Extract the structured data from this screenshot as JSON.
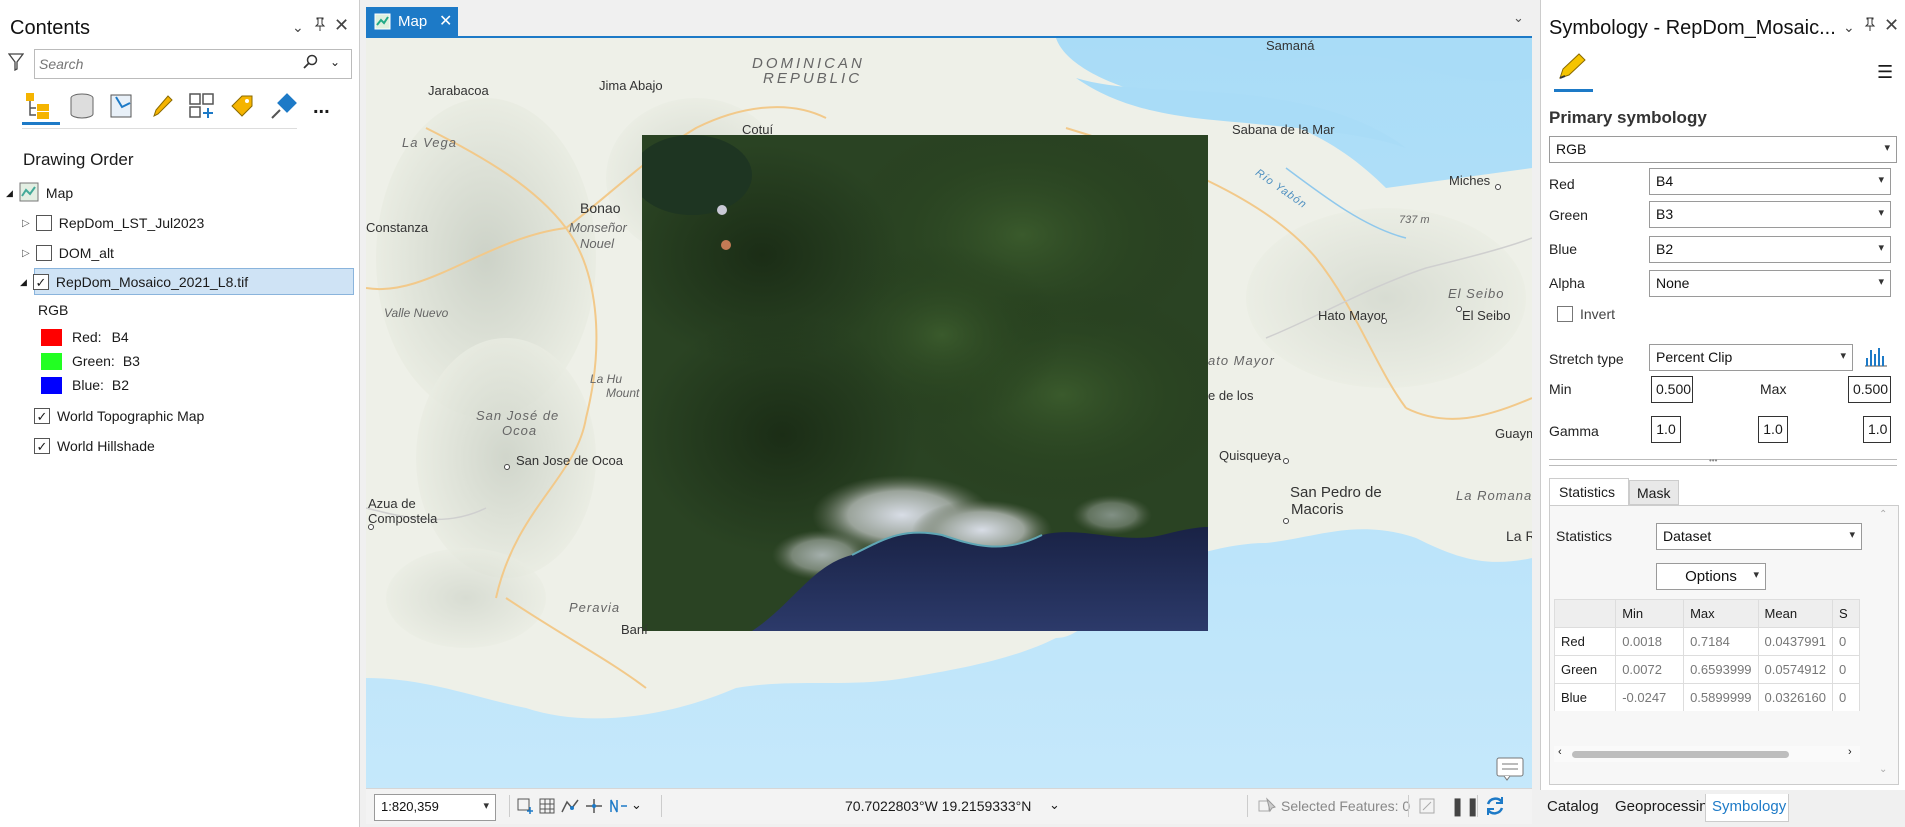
{
  "contents": {
    "title": "Contents",
    "search_placeholder": "Search",
    "drawing_order": "Drawing Order",
    "map_label": "Map",
    "layers": [
      {
        "name": "RepDom_LST_Jul2023",
        "checked": false
      },
      {
        "name": "DOM_alt",
        "checked": false
      },
      {
        "name": "RepDom_Mosaico_2021_L8.tif",
        "checked": true
      }
    ],
    "rgb_label": "RGB",
    "bands": [
      {
        "label": "Red:",
        "value": "B4",
        "color": "#ff0000"
      },
      {
        "label": "Green:",
        "value": "B3",
        "color": "#22ff22"
      },
      {
        "label": "Blue:",
        "value": "B2",
        "color": "#0000ff"
      }
    ],
    "basemaps": [
      "World Topographic Map",
      "World Hillshade"
    ],
    "more": "..."
  },
  "map": {
    "tab_label": "Map",
    "scale": "1:820,359",
    "coordinates": "70.7022803°W 19.2159333°N",
    "selected_features": "Selected Features: 0",
    "places": {
      "dominican": "DOMINICAN",
      "republic": "REPUBLIC",
      "jarabacoa": "Jarabacoa",
      "jima_abajo": "Jima Abajo",
      "cotui": "Cotuí",
      "sabana": "Sabana de la Mar",
      "samana": "Samaná",
      "la_vega": "La Vega",
      "bonao": "Bonao",
      "constanza": "Constanza",
      "monsenor": "Monseñor",
      "nouel": "Nouel",
      "miches": "Miches",
      "rio_yabon": "Río Yabón",
      "m737": "737 m",
      "el_seibo_it": "El Seibo",
      "el_seibo": "El Seibo",
      "hato_mayor": "Hato Mayor",
      "ato_mayor_it": "ato Mayor",
      "valle_nuevo": "Valle Nuevo",
      "la_humo1": "La Hu",
      "la_humo2": "Mount",
      "sj_ocoa_it1": "San José de",
      "sj_ocoa_it2": "Ocoa",
      "sj_ocoa": "San Jose de Ocoa",
      "de_los": "e de los",
      "quisqueya": "Quisqueya",
      "guaym": "Guaym",
      "spm1": "San Pedro de",
      "spm2": "Macoris",
      "la_romana_it": "La Romana",
      "la_romana": "La Ro",
      "azua1": "Azua de",
      "azua2": "Compostela",
      "peravia": "Peravia",
      "bani": "Baní"
    }
  },
  "symbology": {
    "title": "Symbology - RepDom_Mosaic...",
    "primary": "Primary symbology",
    "renderer": "RGB",
    "red_label": "Red",
    "red": "B4",
    "green_label": "Green",
    "green": "B3",
    "blue_label": "Blue",
    "blue": "B2",
    "alpha_label": "Alpha",
    "alpha": "None",
    "invert": "Invert",
    "stretch_label": "Stretch type",
    "stretch": "Percent Clip",
    "min_label": "Min",
    "min": "0.500",
    "max_label": "Max",
    "max": "0.500",
    "gamma_label": "Gamma",
    "gamma": [
      "1.0",
      "1.0",
      "1.0"
    ],
    "tab_statistics": "Statistics",
    "tab_mask": "Mask",
    "statistics_label": "Statistics",
    "statistics_value": "Dataset",
    "options": "Options",
    "table": {
      "headers": [
        "",
        "Min",
        "Max",
        "Mean",
        "S"
      ],
      "rows": [
        [
          "Red",
          "0.0018",
          "0.7184",
          "0.0437991",
          "0"
        ],
        [
          "Green",
          "0.0072",
          "0.6593999",
          "0.0574912",
          "0"
        ],
        [
          "Blue",
          "-0.0247",
          "0.5899999",
          "0.0326160",
          "0"
        ]
      ]
    }
  },
  "bottom_tabs": [
    "Catalog",
    "Geoprocessing",
    "Symbology"
  ]
}
